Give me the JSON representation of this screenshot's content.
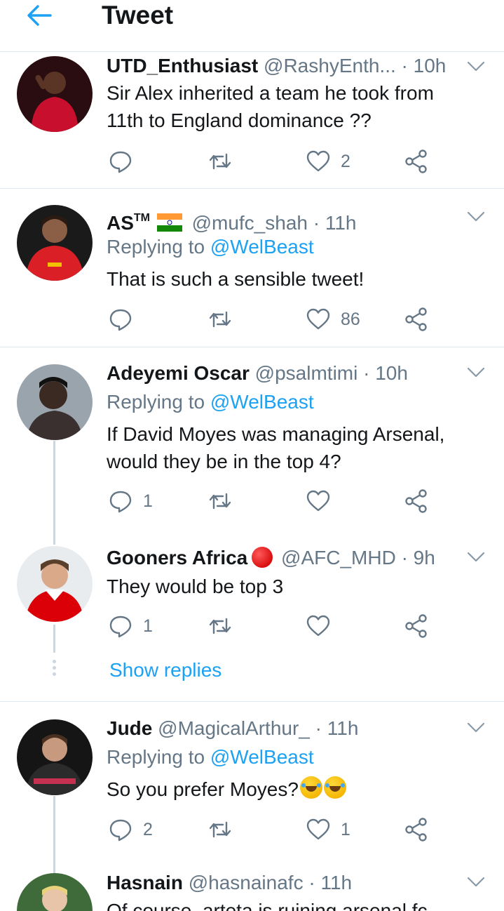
{
  "header": {
    "title": "Tweet"
  },
  "tweets": [
    {
      "name": "UTD_Enthusiast",
      "handle": "@RashyEnth...",
      "time": " · 10h",
      "text": "Sir Alex inherited a team he took from 11th to England dominance ??",
      "replies": "",
      "retweets": "",
      "likes": "2"
    },
    {
      "name": "AS",
      "tm": "TM",
      "handle": "@mufc_shah",
      "time": " · 11h",
      "reply_prefix": "Replying to ",
      "reply_to": "@WelBeast",
      "text": "That is such a sensible tweet!",
      "replies": "",
      "retweets": "",
      "likes": "86"
    },
    {
      "name": "Adeyemi Oscar",
      "handle": "@psalmtimi",
      "time": " · 10h",
      "reply_prefix": "Replying to ",
      "reply_to": "@WelBeast",
      "text": "If David Moyes was managing Arsenal, would they be in the top 4?",
      "replies": "1",
      "retweets": "",
      "likes": ""
    },
    {
      "name": "Gooners Africa",
      "handle": "@AFC_MHD",
      "time": " · 9h",
      "text": "They would be top 3",
      "replies": "1",
      "retweets": "",
      "likes": "",
      "show_replies": "Show replies"
    },
    {
      "name": "Jude",
      "handle": "@MagicalArthur_",
      "time": " · 11h",
      "reply_prefix": "Replying to ",
      "reply_to": "@WelBeast",
      "text": "So you prefer Moyes?",
      "replies": "2",
      "retweets": "",
      "likes": "1"
    },
    {
      "name": "Hasnain",
      "handle": "@hasnainafc",
      "time": " · 11h",
      "text": "Of course, arteta is ruining arsenal fc"
    }
  ],
  "colors": {
    "accent": "#1da1f2",
    "text": "#14171a",
    "secondary": "#657786",
    "divider": "#e1e8ed",
    "thread_line": "#cdd6dd"
  },
  "icons": {
    "back": "arrow-left-icon",
    "reply": "comment-bubble-icon",
    "retweet": "retweet-icon",
    "like": "heart-icon",
    "share": "share-nodes-icon",
    "more": "chevron-down-icon"
  }
}
